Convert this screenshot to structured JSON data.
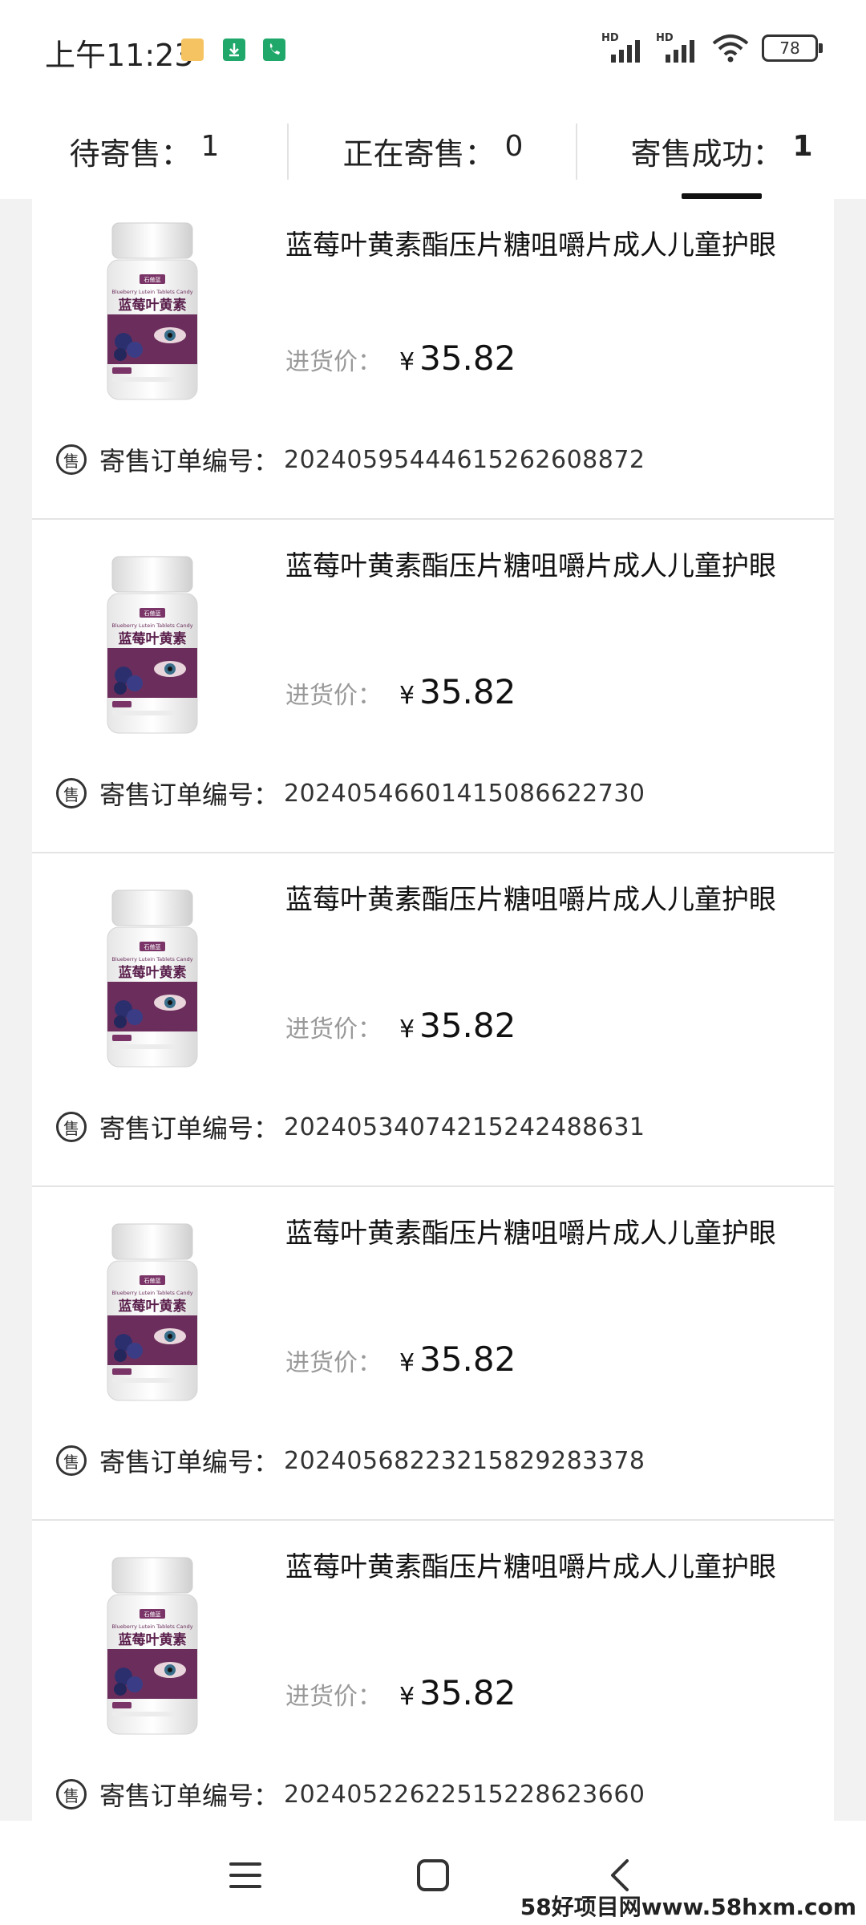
{
  "status_bar": {
    "time": "上午11:23",
    "battery": "78",
    "notification_icons": [
      "message-icon",
      "download-icon",
      "phone-icon"
    ],
    "signal_labels": [
      "HD",
      "HD"
    ]
  },
  "tabs": [
    {
      "label": "待寄售：",
      "count": "1",
      "active": false
    },
    {
      "label": "正在寄售：",
      "count": "0",
      "active": false
    },
    {
      "label": "寄售成功：",
      "count": "1",
      "active": true
    }
  ],
  "product_image_text": {
    "brand": "石傲蓝",
    "english": "Blueberry Lutein Tablets Candy",
    "chinese": "蓝莓叶黄素"
  },
  "order_label": "寄售订单编号：",
  "price_label": "进货价：",
  "currency": "¥",
  "sell_icon_char": "售",
  "orders": [
    {
      "title": "蓝莓叶黄素酯压片糖咀嚼片成人儿童护眼",
      "price": "35.82",
      "order_no": "20240595444615262608872"
    },
    {
      "title": "蓝莓叶黄素酯压片糖咀嚼片成人儿童护眼",
      "price": "35.82",
      "order_no": "20240546601415086622730"
    },
    {
      "title": "蓝莓叶黄素酯压片糖咀嚼片成人儿童护眼",
      "price": "35.82",
      "order_no": "20240534074215242488631"
    },
    {
      "title": "蓝莓叶黄素酯压片糖咀嚼片成人儿童护眼",
      "price": "35.82",
      "order_no": "20240568223215829283378"
    },
    {
      "title": "蓝莓叶黄素酯压片糖咀嚼片成人儿童护眼",
      "price": "35.82",
      "order_no": "20240522622515228623660"
    }
  ],
  "watermark": "58好项目网www.58hxm.com",
  "colors": {
    "background": "#f2f2f2",
    "card": "#ffffff",
    "label_gray": "#999999",
    "product_purple": "#6b2e5c"
  }
}
